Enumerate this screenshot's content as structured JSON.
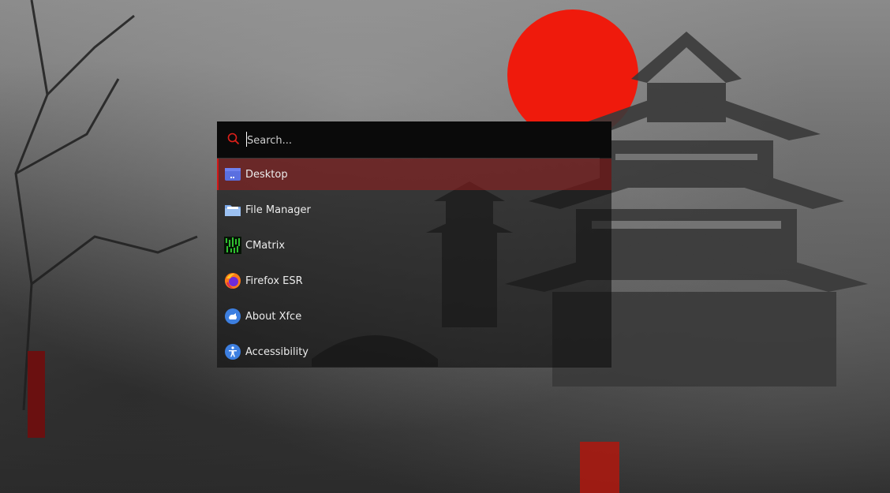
{
  "launcher": {
    "search": {
      "placeholder": "Search...",
      "value": ""
    },
    "items": [
      {
        "label": "Desktop",
        "icon": "desktop-icon",
        "selected": true
      },
      {
        "label": "File Manager",
        "icon": "folder-icon",
        "selected": false
      },
      {
        "label": "CMatrix",
        "icon": "cmatrix-icon",
        "selected": false
      },
      {
        "label": "Firefox ESR",
        "icon": "firefox-icon",
        "selected": false
      },
      {
        "label": "About Xfce",
        "icon": "xfce-mouse-icon",
        "selected": false
      },
      {
        "label": "Accessibility",
        "icon": "accessibility-icon",
        "selected": false
      }
    ]
  },
  "colors": {
    "accent": "#d01818",
    "sun": "#ef1a0c",
    "selection": "#7a1f1f"
  }
}
